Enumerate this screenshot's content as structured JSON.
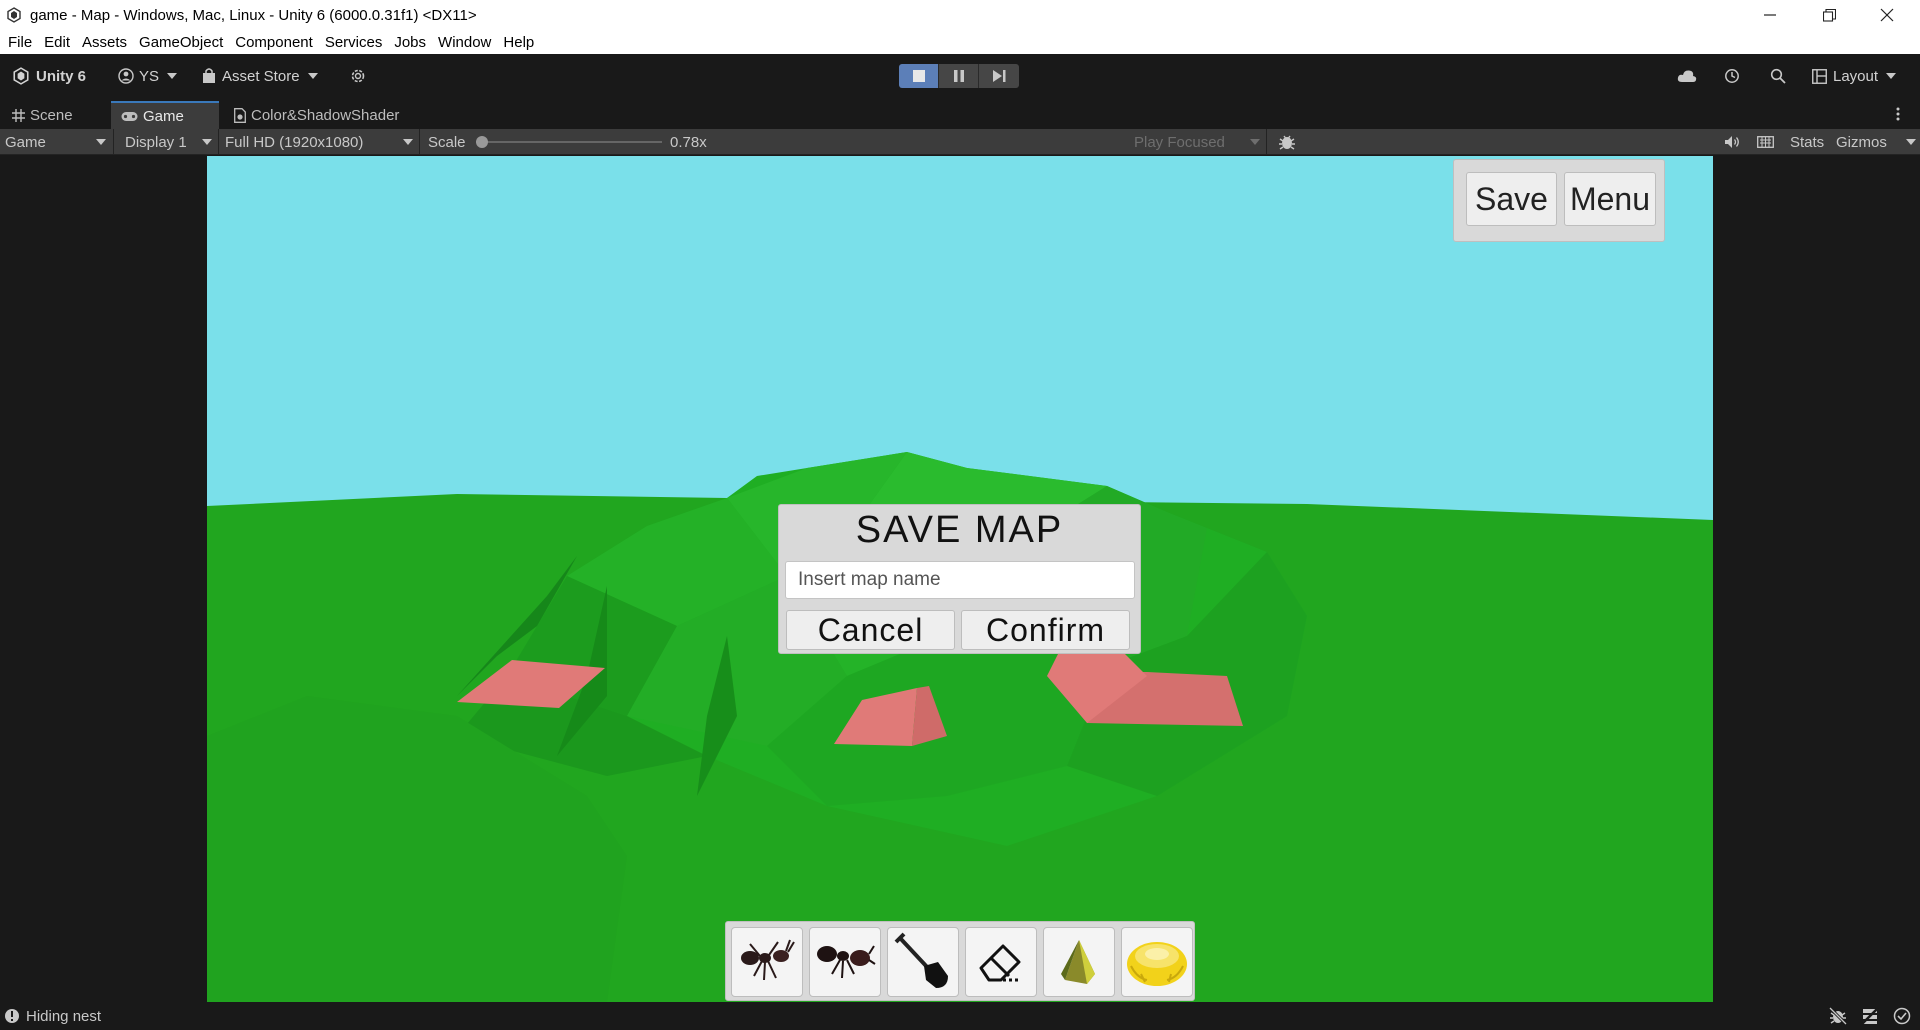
{
  "window": {
    "title": "game - Map - Windows, Mac, Linux - Unity 6 (6000.0.31f1) <DX11>"
  },
  "menu": [
    "File",
    "Edit",
    "Assets",
    "GameObject",
    "Component",
    "Services",
    "Jobs",
    "Window",
    "Help"
  ],
  "toolbar": {
    "unity_label": "Unity 6",
    "account_label": "YS",
    "asset_store_label": "Asset Store",
    "layout_label": "Layout"
  },
  "tabs": [
    "Scene",
    "Game",
    "Color&ShadowShader"
  ],
  "game_controls": {
    "mode": "Game",
    "display": "Display 1",
    "resolution": "Full HD (1920x1080)",
    "scale_label": "Scale",
    "scale_value": "0.78x",
    "scale_fraction": 0.0,
    "play_focused": "Play Focused",
    "stats": "Stats",
    "gizmos": "Gizmos"
  },
  "game_ui": {
    "save_button": "Save",
    "menu_button": "Menu",
    "dialog": {
      "title": "SAVE MAP",
      "input_placeholder": "Insert map name",
      "cancel": "Cancel",
      "confirm": "Confirm"
    },
    "tools": [
      "ant-worker-icon",
      "ant-soldier-icon",
      "shovel-icon",
      "eraser-icon",
      "rock-icon",
      "food-icon"
    ]
  },
  "colors": {
    "sky": "#7ae0ea",
    "ground": "#21a61f",
    "nest": "#e07a78",
    "editor_bg": "#191919",
    "play_active": "#5c7fb8"
  },
  "status": {
    "text": "Hiding nest"
  }
}
